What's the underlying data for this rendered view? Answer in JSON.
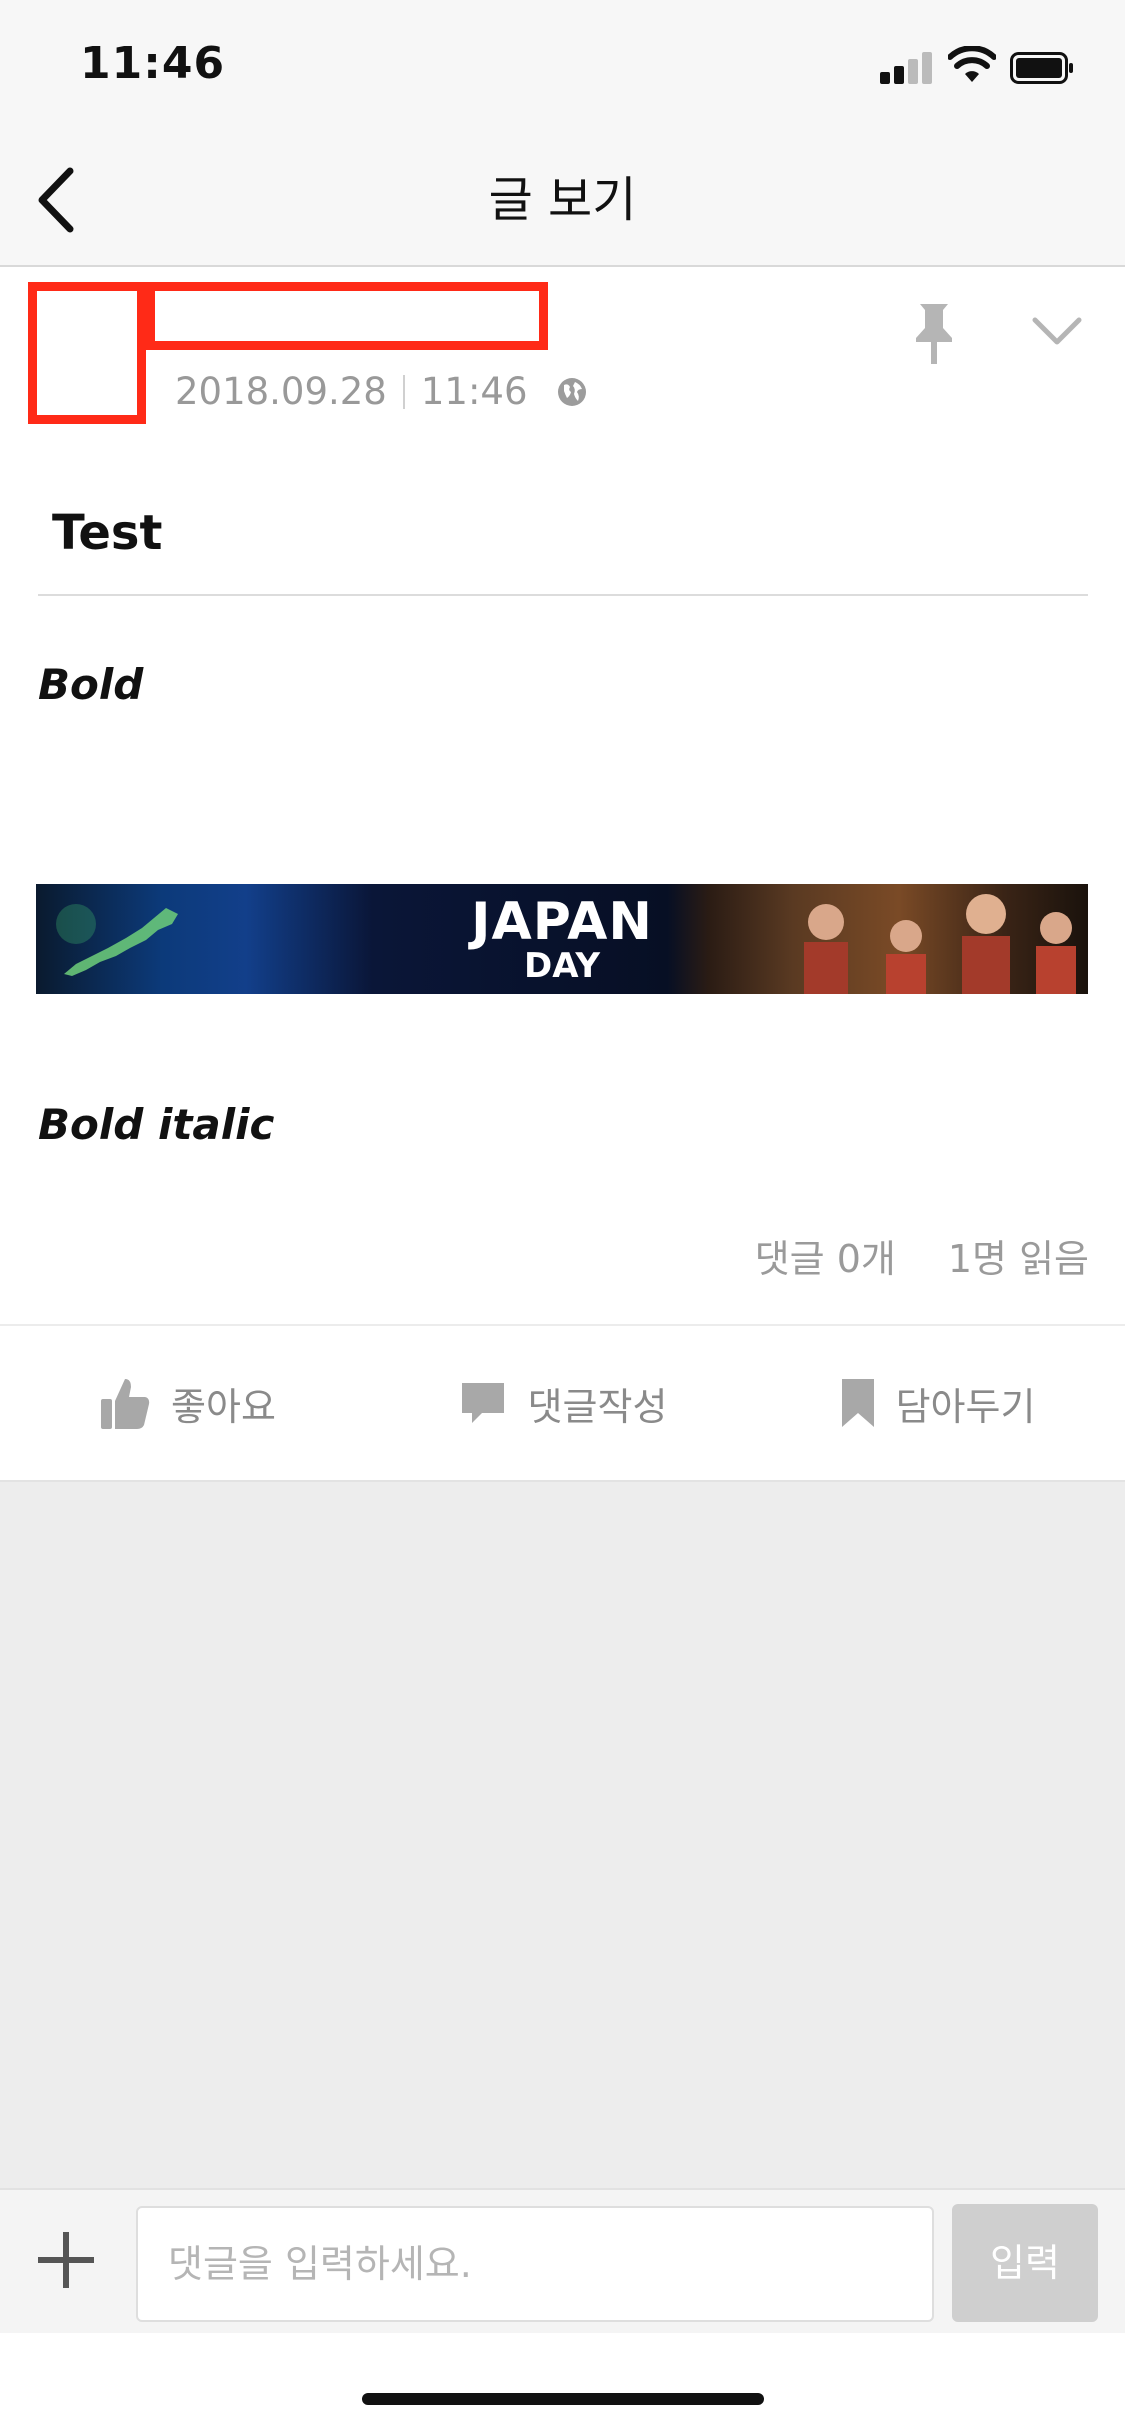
{
  "status_bar": {
    "time": "11:46"
  },
  "nav": {
    "title": "글 보기",
    "back_icon": "chevron-left-icon"
  },
  "post": {
    "date": "2018.09.28",
    "time": "11:46",
    "visibility_icon": "globe-icon",
    "title": "Test",
    "body": {
      "bold_text": "Bold",
      "banner": {
        "line1": "JAPAN",
        "line2": "DAY"
      },
      "bold_italic_text": "Bold italic"
    },
    "stats": {
      "comments": "댓글 0개",
      "reads": "1명 읽음"
    }
  },
  "actions": {
    "like": "좋아요",
    "comment": "댓글작성",
    "bookmark": "담아두기"
  },
  "comment_bar": {
    "placeholder": "댓글을 입력하세요.",
    "submit": "입력"
  },
  "colors": {
    "redaction": "#ff2a17",
    "muted_text": "#999999",
    "background_gray": "#ededed",
    "submit_disabled": "#cfcfcf"
  }
}
